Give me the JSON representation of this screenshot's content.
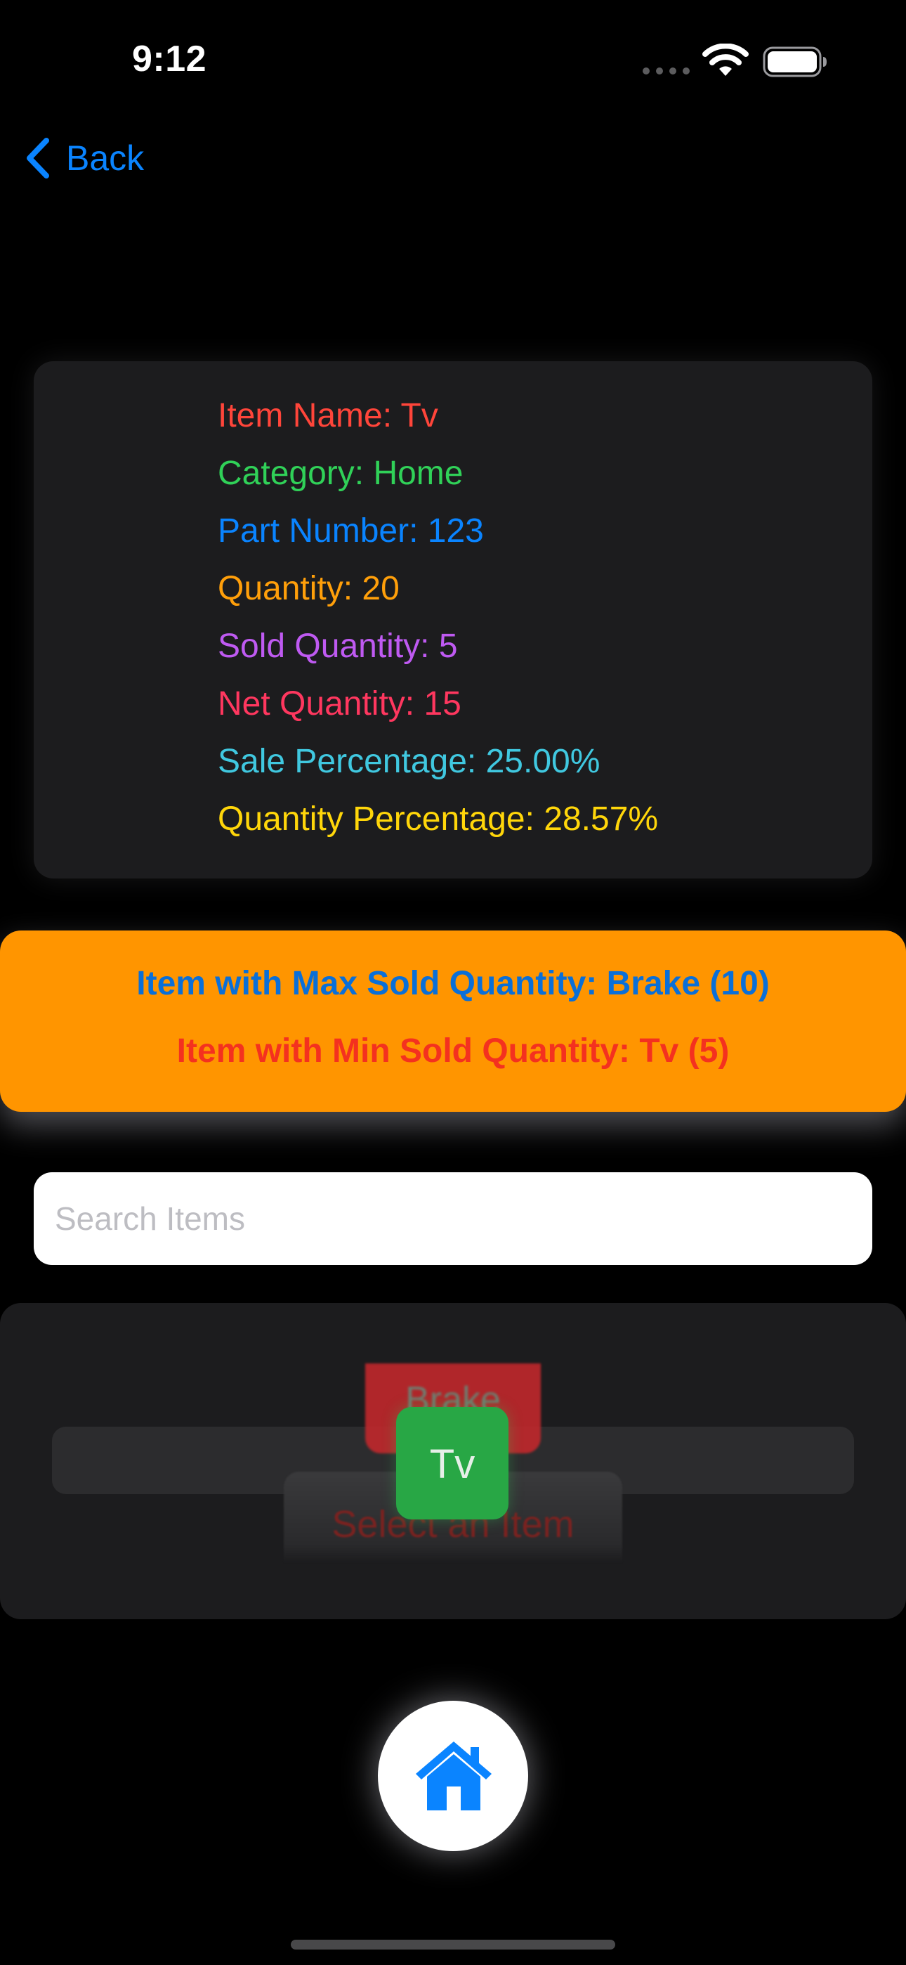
{
  "status_bar": {
    "time": "9:12",
    "icons": [
      "signal-dots-icon",
      "wifi-icon",
      "battery-icon"
    ]
  },
  "nav": {
    "back_label": "Back",
    "back_icon": "chevron-left-icon"
  },
  "item_details": {
    "item_name": "Item Name: Tv",
    "category": "Category: Home",
    "part_number": "Part Number: 123",
    "quantity": "Quantity: 20",
    "sold_quantity": "Sold Quantity: 5",
    "net_quantity": "Net Quantity: 15",
    "sale_percentage": "Sale Percentage: 25.00%",
    "quantity_percentage": "Quantity Percentage: 28.57%"
  },
  "stats": {
    "max_sold": "Item with Max Sold Quantity: Brake (10)",
    "min_sold": "Item with Min Sold Quantity: Tv (5)"
  },
  "search": {
    "placeholder": "Search Items",
    "value": ""
  },
  "picker": {
    "options": [
      "Brake",
      "Tv",
      "Select an Item"
    ],
    "selected": "Tv"
  },
  "tab_bar": {
    "home_icon": "house-icon"
  },
  "colors": {
    "background": "#000000",
    "card": "#1c1c1e",
    "accent_blue": "#0a84ff",
    "item_name": "#ff453a",
    "category": "#30d158",
    "part_number": "#0a84ff",
    "quantity": "#ff9f0a",
    "sold_quantity": "#bf5af2",
    "net_quantity": "#ff375f",
    "sale_percentage": "#40c8e0",
    "quantity_percentage": "#ffd60a",
    "banner": "#ff9500",
    "max_sold_text": "#0a6fd8",
    "min_sold_text": "#f4311f",
    "picker_selected": "#28a745",
    "picker_top": "#c5282c"
  }
}
